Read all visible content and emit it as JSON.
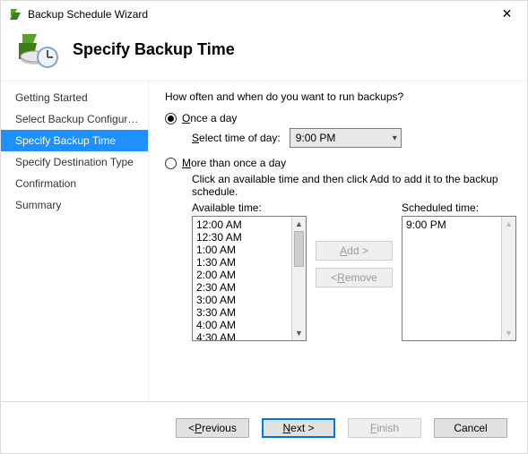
{
  "window": {
    "title": "Backup Schedule Wizard",
    "heading": "Specify Backup Time"
  },
  "nav": {
    "items": [
      {
        "label": "Getting Started"
      },
      {
        "label": "Select Backup Configurat..."
      },
      {
        "label": "Specify Backup Time"
      },
      {
        "label": "Specify Destination Type"
      },
      {
        "label": "Confirmation"
      },
      {
        "label": "Summary"
      }
    ],
    "activeIndex": 2
  },
  "main": {
    "prompt": "How often and when do you want to run backups?",
    "once": {
      "label_prefix": "O",
      "label_rest": "nce a day",
      "time_label_prefix": "S",
      "time_label_rest": "elect time of day:",
      "time_value": "9:00 PM",
      "checked": true
    },
    "multi": {
      "label_prefix": "M",
      "label_rest": "ore than once a day",
      "checked": false,
      "instruction": "Click an available time and then click Add to add it to the backup schedule.",
      "available_label": "Available time:",
      "scheduled_label": "Scheduled time:",
      "available_times": [
        "12:00 AM",
        "12:30 AM",
        "1:00 AM",
        "1:30 AM",
        "2:00 AM",
        "2:30 AM",
        "3:00 AM",
        "3:30 AM",
        "4:00 AM",
        "4:30 AM"
      ],
      "scheduled_times": [
        "9:00 PM"
      ],
      "add_label_prefix": "A",
      "add_label_rest": "dd >",
      "remove_label_prefix": "R",
      "remove_label_rest": "emove"
    }
  },
  "footer": {
    "previous_prefix": "P",
    "previous_rest": "revious",
    "next_prefix": "N",
    "next_rest": "ext >",
    "finish_prefix": "F",
    "finish_rest": "inish",
    "cancel": "Cancel"
  }
}
